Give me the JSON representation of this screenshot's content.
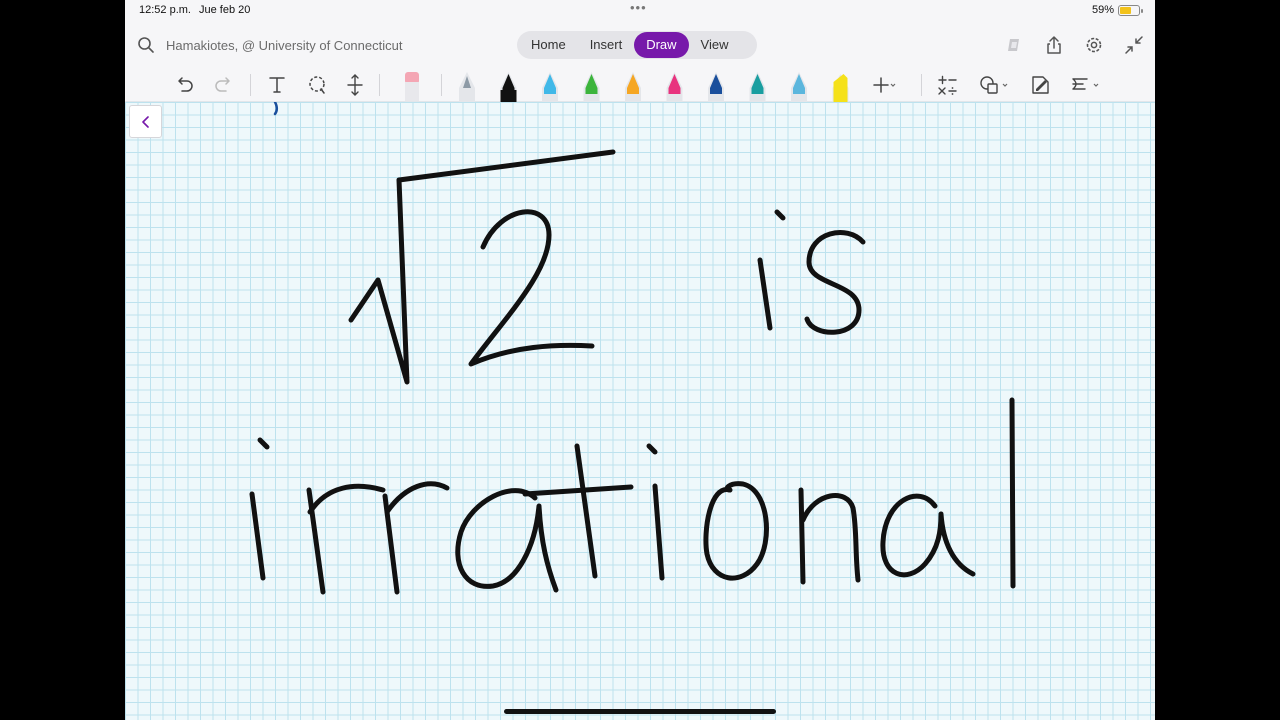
{
  "status_bar": {
    "time": "12:52 p.m.",
    "date": "Jue feb 20",
    "dots": "•••",
    "battery_pct": "59%",
    "battery_level": 0.59,
    "battery_color": "#f2c21b"
  },
  "title_bar": {
    "search_icon": "search-icon",
    "notebook_path": "Hamakiotes, @ University of Connecticut",
    "tabs": [
      {
        "label": "Home",
        "active": false
      },
      {
        "label": "Insert",
        "active": false
      },
      {
        "label": "Draw",
        "active": true
      },
      {
        "label": "View",
        "active": false
      }
    ],
    "accent_color": "#7719aa",
    "right_icons": [
      "copilot-icon",
      "share-icon",
      "settings-icon",
      "collapse-icon"
    ]
  },
  "draw_toolbar": {
    "tools": [
      "undo-icon",
      "redo-icon",
      "text-tool-icon",
      "lasso-select-icon",
      "add-space-icon",
      "eraser-icon"
    ],
    "pens": [
      {
        "name": "pencil",
        "color": "#8d9aa6"
      },
      {
        "name": "pen-black",
        "color": "#111111"
      },
      {
        "name": "pen-light-blue",
        "color": "#40b8e8"
      },
      {
        "name": "pen-green",
        "color": "#3cb43c"
      },
      {
        "name": "pen-orange",
        "color": "#f5a623"
      },
      {
        "name": "pen-pink",
        "color": "#e8337e"
      },
      {
        "name": "pen-dark-blue",
        "color": "#1a4f9c"
      },
      {
        "name": "pen-teal",
        "color": "#1a9ea0"
      },
      {
        "name": "pen-sky",
        "color": "#5bb6dd"
      },
      {
        "name": "highlighter-yellow",
        "color": "#f5e11a"
      }
    ],
    "extra_tools": [
      "add-pen-icon",
      "ink-to-math-icon",
      "shapes-icon",
      "ink-to-shape-icon",
      "ruler-icon"
    ]
  },
  "canvas": {
    "grid_color": "#bde2ee",
    "background_color": "#eef8fb",
    "handwriting": "√2 is irrational",
    "back_icon": "chevron-left-icon"
  }
}
